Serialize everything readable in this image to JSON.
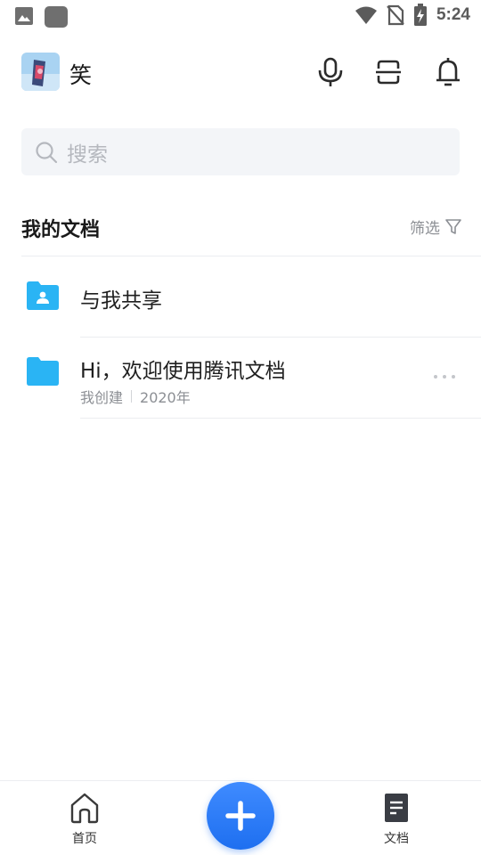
{
  "status_bar": {
    "time": "5:24",
    "icons": [
      "image-icon",
      "app-square-icon",
      "wifi-icon",
      "no-sim-icon",
      "battery-charging-icon"
    ]
  },
  "header": {
    "user_name": "笑",
    "icons": [
      "avatar",
      "microphone-icon",
      "scan-icon",
      "bell-icon"
    ]
  },
  "search": {
    "placeholder": "搜索"
  },
  "section": {
    "title": "我的文档",
    "filter_label": "筛选"
  },
  "list": {
    "items": [
      {
        "title": "与我共享",
        "icon": "shared-folder-icon",
        "color": "#2ab4f4"
      },
      {
        "title": "Hi，欢迎使用腾讯文档",
        "icon": "folder-icon",
        "color": "#2ab4f4",
        "meta_creator": "我创建",
        "meta_date": "2020年"
      }
    ]
  },
  "bottom_nav": {
    "home_label": "首页",
    "docs_label": "文档"
  },
  "colors": {
    "accent": "#1e6ff0",
    "folder": "#2ab4f4",
    "secondary_text": "#8c8f94",
    "search_bg": "#f3f5f8"
  }
}
